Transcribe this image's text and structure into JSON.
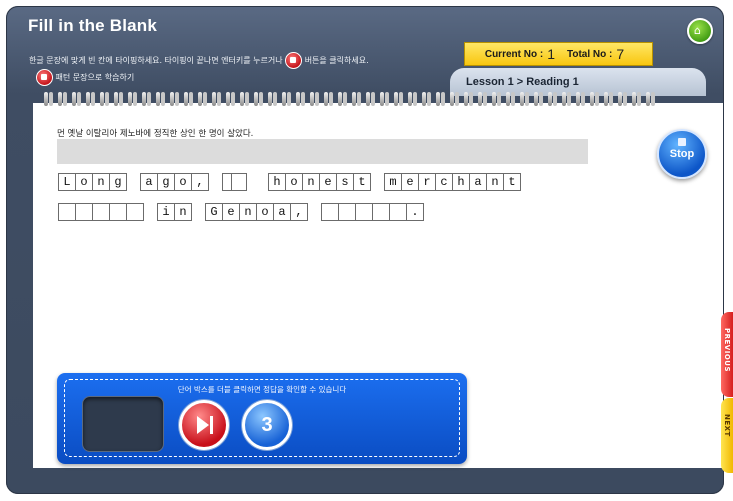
{
  "header": {
    "title": "Fill in the Blank",
    "instruction_part1": "한글 문장에 맞게 빈 칸에 타이핑하세요. 타이핑이 끝나면 엔터키를 누르거나",
    "instruction_part2": "버튼을 클릭하세요.",
    "pattern_link": "패턴 문장으로 학습하기"
  },
  "counter": {
    "current_label": "Current No :",
    "current_value": "1",
    "total_label": "Total No :",
    "total_value": "7"
  },
  "breadcrumb": "Lesson 1 > Reading 1",
  "exercise": {
    "korean_sentence": "먼 옛날 이탈리아 제노바에 정직한 상인 한 명이 살았다."
  },
  "stop_label": "Stop",
  "tray": {
    "message": "단어 박스를 더블 클릭하면 정답을 확인할 수 있습니다",
    "hint_count": "3"
  },
  "nav": {
    "previous_label": "PREVIOUS",
    "next_label": "NEXT"
  },
  "colors": {
    "frame": "#3f4d63",
    "counter_bg": "#f8c60f",
    "tray": "#0a4cc2",
    "accent_red": "#c80f1a",
    "accent_blue": "#1762d6"
  },
  "icons": {
    "home": "home-icon",
    "submit": "submit-icon",
    "pattern": "pattern-icon",
    "stop": "stop-icon",
    "play": "play-next-icon"
  }
}
